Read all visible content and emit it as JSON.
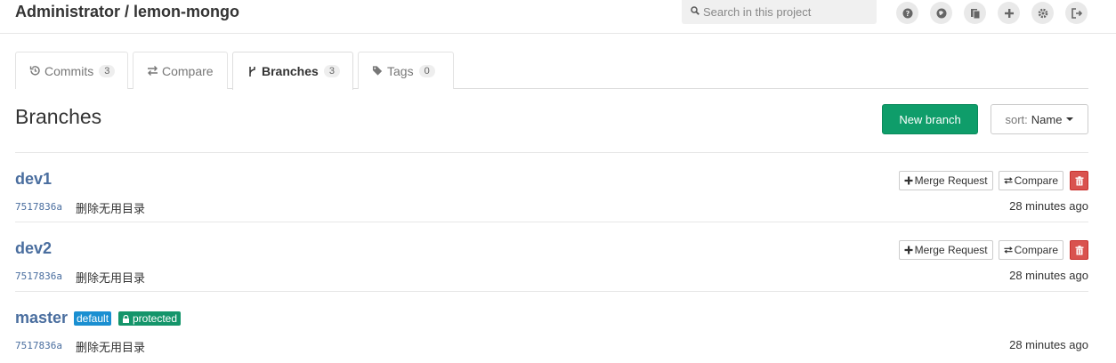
{
  "header": {
    "title": "Administrator / lemon-mongo",
    "search_placeholder": "Search in this project",
    "icons": [
      "help-icon",
      "globe-icon",
      "snippets-icon",
      "plus-icon",
      "gear-icon",
      "logout-icon"
    ]
  },
  "tabs": [
    {
      "label": "Commits",
      "count": "3",
      "icon": "history-icon"
    },
    {
      "label": "Compare",
      "icon": "exchange-icon"
    },
    {
      "label": "Branches",
      "count": "3",
      "icon": "branch-icon",
      "active": true
    },
    {
      "label": "Tags",
      "count": "0",
      "icon": "tag-icon"
    }
  ],
  "page": {
    "title": "Branches",
    "new_branch_label": "New branch",
    "sort_label": "sort:",
    "sort_value": "Name"
  },
  "branches": [
    {
      "name": "dev1",
      "sha": "7517836a",
      "message": "删除无用目录",
      "time": "28 minutes ago",
      "merge_label": "Merge Request",
      "compare_label": "Compare"
    },
    {
      "name": "dev2",
      "sha": "7517836a",
      "message": "删除无用目录",
      "time": "28 minutes ago",
      "merge_label": "Merge Request",
      "compare_label": "Compare"
    },
    {
      "name": "master",
      "sha": "7517836a",
      "message": "删除无用目录",
      "time": "28 minutes ago",
      "default_label": "default",
      "protected_label": "protected"
    }
  ],
  "colors": {
    "accent_green": "#0f9d6a",
    "link_blue": "#4a6e9f",
    "danger_red": "#d9534f",
    "default_label_blue": "#1a8fd1"
  }
}
